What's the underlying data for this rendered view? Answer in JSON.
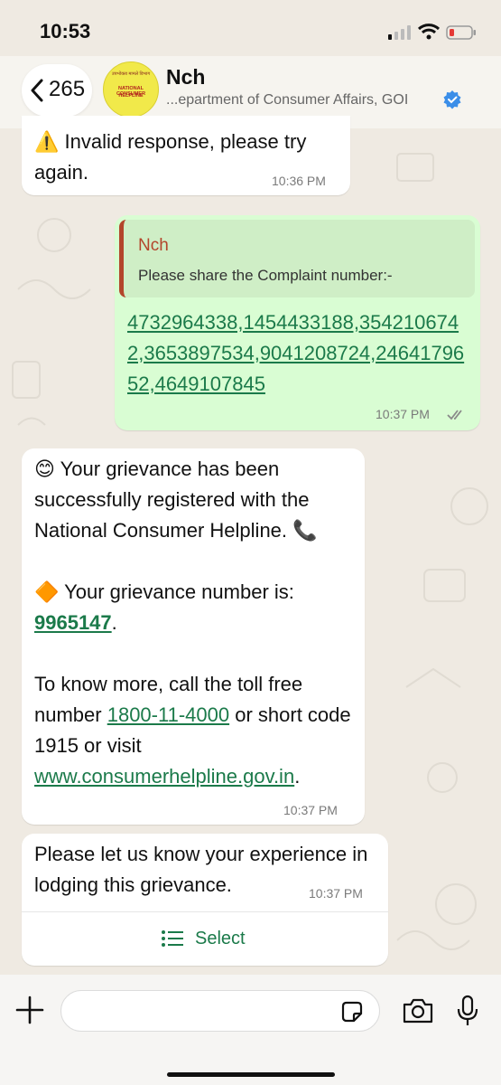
{
  "status_bar": {
    "time": "10:53"
  },
  "header": {
    "back_count": "265",
    "contact_name": "Nch",
    "contact_subtitle": "...epartment of Consumer Affairs, GOI",
    "avatar": {
      "top_text": "उपभोक्ता मामले विभाग",
      "line1": "NATIONAL CONSUMER",
      "line2": "HELPLINE"
    }
  },
  "messages": {
    "m1": {
      "text": "⚠️ Invalid response, please try again.",
      "time": "10:36 PM"
    },
    "m2": {
      "quote_name": "Nch",
      "quote_text": "Please share the Complaint number:-",
      "numbers": "4732964338,1454433188,3542106742,3653897534,9041208724,2464179652,4649107845",
      "time": "10:37 PM"
    },
    "m3": {
      "line1": "😊 Your grievance has been successfully registered with the National Consumer Helpline. 📞",
      "line2_prefix": "🔶 Your grievance number is:",
      "grievance_number": "9965147",
      "period": ".",
      "line3_prefix": "To know more, call the toll free number",
      "toll_free": "1800-11-4000",
      "line3_mid": "or short code 1915 or visit",
      "website": "www.consumerhelpline.gov.in",
      "time": "10:37 PM"
    },
    "m4": {
      "text": "Please let us know your experience in lodging  this grievance.",
      "time": "10:37 PM",
      "button_label": "Select"
    }
  },
  "colors": {
    "accent": "#1b7a4a",
    "outgoing_bubble": "#d9fdd3",
    "quote_bar": "#b3452b",
    "background": "#efeae2",
    "verified": "#3b8ee8"
  },
  "icons": [
    "back-chevron-icon",
    "verified-badge-icon",
    "double-check-icon",
    "list-icon",
    "plus-icon",
    "sticker-icon",
    "camera-icon",
    "microphone-icon"
  ]
}
